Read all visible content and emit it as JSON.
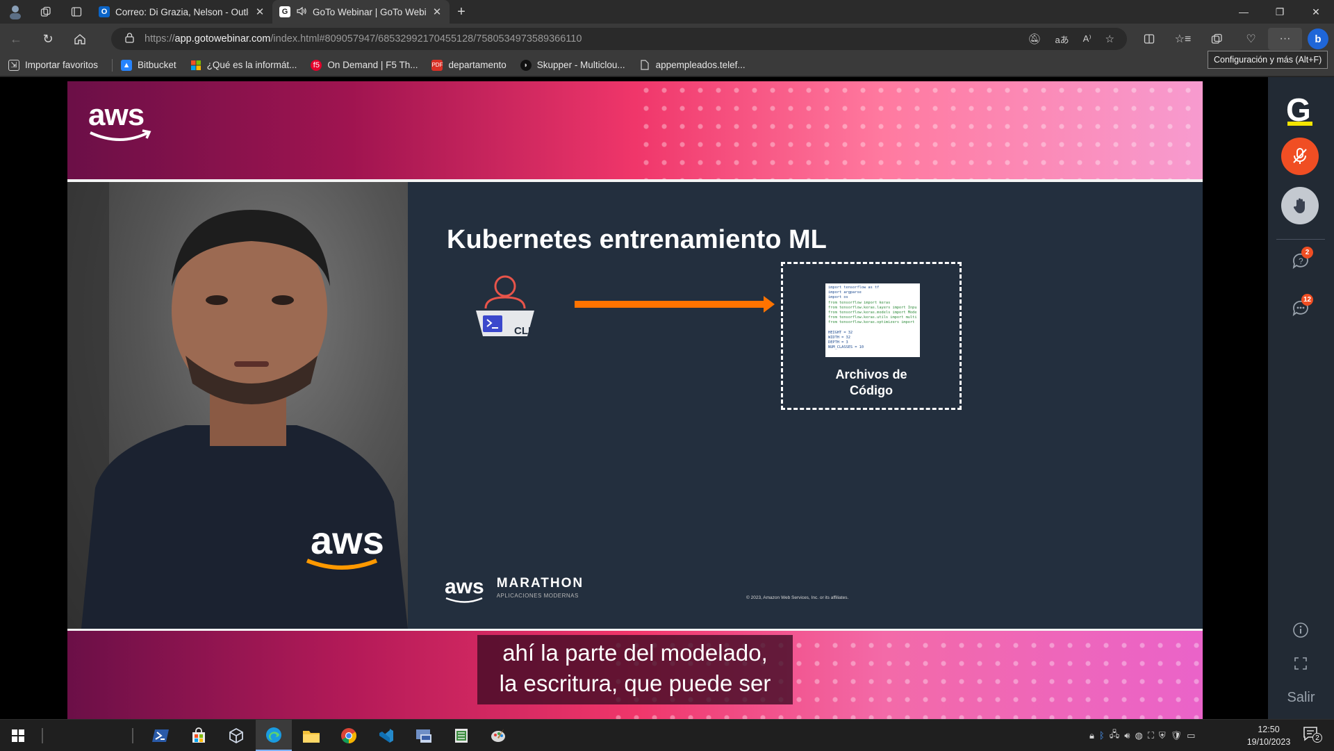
{
  "browser": {
    "tabs": [
      {
        "title": "Correo: Di Grazia, Nelson - Outlo",
        "favicon": "outlook-icon",
        "active": false
      },
      {
        "title": "GoTo Webinar | GoTo Webin",
        "favicon": "goto-icon",
        "active": true
      }
    ],
    "url_scheme": "https://",
    "url_host": "app.gotowebinar.com",
    "url_path": "/index.html#809057947/6853299217045512​8/7580534973589366110",
    "tooltip": "Configuración y más (Alt+F)",
    "bookmarks": [
      {
        "label": "Importar favoritos",
        "icon": "import-icon"
      },
      {
        "label": "Bitbucket",
        "icon": "bitbucket-icon"
      },
      {
        "label": "¿Qué es la informát...",
        "icon": "microsoft-icon"
      },
      {
        "label": "On Demand | F5 Th...",
        "icon": "f5-icon"
      },
      {
        "label": "departamento",
        "icon": "pdf-icon"
      },
      {
        "label": "Skupper - Multiclou...",
        "icon": "skupper-icon"
      },
      {
        "label": "appempleados.telef...",
        "icon": "page-icon"
      }
    ]
  },
  "slide": {
    "title": "Kubernetes entrenamiento ML",
    "cli_label": "CLI",
    "box_label_line1": "Archivos de",
    "box_label_line2": "Código",
    "code_lines": [
      "import tensorflow as tf",
      "import argparse",
      "import os",
      "from tensorflow import keras",
      "from tensorflow.keras.layers import Inpu",
      "from tensorflow.keras.models import Mode",
      "from tensorflow.keras.utils import multi",
      "from tensorflow.keras.optimizers import ",
      "",
      "HEIGHT = 32",
      "WIDTH = 32",
      "DEPTH = 3",
      "NUM_CLASSES = 10"
    ],
    "brand_logo": "aws",
    "event_name": "MARATHON",
    "event_subtitle": "APLICACIONES MODERNAS",
    "copyright": "© 2023, Amazon Web Services, Inc. or its affiliates."
  },
  "presenter": {
    "shirt_logo": "aws"
  },
  "caption": {
    "line1": "ahí la parte del modelado,",
    "line2": "la escritura, que puede ser"
  },
  "goto_panel": {
    "logo": "G",
    "questions_badge": "2",
    "chat_badge": "12",
    "exit_label": "Salir"
  },
  "taskbar": {
    "time": "12:50",
    "date": "19/10/2023",
    "notifications": "2"
  }
}
